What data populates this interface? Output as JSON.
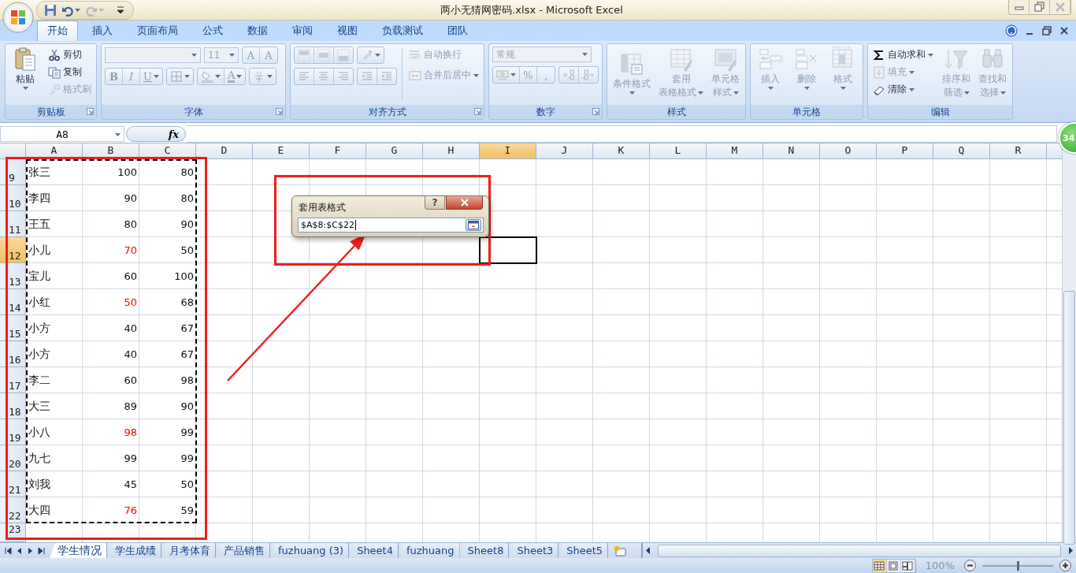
{
  "window": {
    "title": "两小无猜网密码.xlsx - Microsoft Excel"
  },
  "quick_access": [
    {
      "kind": "save",
      "disabled": false
    },
    {
      "kind": "undo",
      "disabled": false
    },
    {
      "kind": "redo",
      "disabled": true
    },
    {
      "kind": "customize",
      "disabled": false
    }
  ],
  "ribbon_tabs": [
    {
      "label": "开始",
      "selected": true
    },
    {
      "label": "插入",
      "selected": false
    },
    {
      "label": "页面布局",
      "selected": false
    },
    {
      "label": "公式",
      "selected": false
    },
    {
      "label": "数据",
      "selected": false
    },
    {
      "label": "审阅",
      "selected": false
    },
    {
      "label": "视图",
      "selected": false
    },
    {
      "label": "负载测试",
      "selected": false
    },
    {
      "label": "团队",
      "selected": false
    }
  ],
  "ribbon_groups": [
    {
      "label": "剪贴板",
      "launcher": true,
      "columns": [
        [
          [
            {
              "kind": "large",
              "lines": [
                "粘贴"
              ],
              "dropdown": true,
              "disabled": false
            }
          ]
        ],
        [
          [
            {
              "kind": "small",
              "label": "剪切",
              "dropdown": false,
              "disabled": false
            }
          ],
          [
            {
              "kind": "small",
              "label": "复制",
              "dropdown": false,
              "disabled": false
            }
          ],
          [
            {
              "kind": "small",
              "label": "格式刷",
              "dropdown": false,
              "disabled": true
            }
          ]
        ]
      ]
    },
    {
      "label": "字体",
      "launcher": true,
      "columns": [
        [
          [
            {
              "kind": "combo",
              "disabled": true
            },
            {
              "kind": "combo",
              "value": "11",
              "disabled": true
            },
            {
              "kind": "segment",
              "disabled": true,
              "buttons": [
                {
                  "label": "A",
                  "dropdown": false
                },
                {
                  "label": "A",
                  "dropdown": false
                }
              ]
            }
          ],
          [
            {
              "kind": "segment",
              "disabled": true,
              "buttons": [
                {
                  "label": "B",
                  "dropdown": false
                },
                {
                  "label": "I",
                  "dropdown": false
                },
                {
                  "label": "U",
                  "dropdown": true
                }
              ]
            },
            {
              "kind": "segment",
              "disabled": true,
              "buttons": [
                {
                  "dropdown": true
                }
              ]
            },
            {
              "kind": "segment",
              "disabled": true,
              "buttons": [
                {
                  "dropdown": true
                },
                {
                  "label": "A",
                  "dropdown": true
                }
              ]
            },
            {
              "kind": "segment",
              "disabled": true,
              "buttons": [
                {
                  "dropdown": true
                }
              ]
            }
          ]
        ]
      ]
    },
    {
      "label": "对齐方式",
      "launcher": true,
      "columns": [
        [
          [
            {
              "kind": "segment",
              "disabled": true,
              "buttons": [
                {
                  "dropdown": false
                },
                {
                  "dropdown": false
                },
                {
                  "dropdown": false
                }
              ]
            },
            {
              "kind": "segment",
              "disabled": true,
              "buttons": [
                {
                  "dropdown": true
                }
              ]
            }
          ],
          [
            {
              "kind": "segment",
              "disabled": true,
              "buttons": [
                {
                  "dropdown": false
                },
                {
                  "dropdown": false
                },
                {
                  "dropdown": false
                }
              ]
            },
            {
              "kind": "segment",
              "disabled": true,
              "buttons": [
                {
                  "dropdown": false
                },
                {
                  "dropdown": false
                }
              ]
            }
          ]
        ],
        [
          [
            {
              "kind": "small",
              "label": "自动换行",
              "dropdown": false,
              "disabled": true
            }
          ],
          [
            {
              "kind": "small",
              "label": "合并后居中",
              "dropdown": true,
              "disabled": true
            }
          ]
        ]
      ]
    },
    {
      "label": "数字",
      "launcher": true,
      "columns": [
        [
          [
            {
              "kind": "combo",
              "value": "常规",
              "disabled": true
            }
          ],
          [
            {
              "kind": "segment",
              "disabled": true,
              "buttons": [
                {
                  "dropdown": true
                },
                {
                  "label": "%",
                  "dropdown": false
                },
                {
                  "label": ",",
                  "dropdown": false
                }
              ]
            },
            {
              "kind": "segment",
              "disabled": true,
              "buttons": [
                {
                  "dropdown": false
                },
                {
                  "dropdown": false
                }
              ]
            }
          ]
        ]
      ]
    },
    {
      "label": "样式",
      "launcher": false,
      "columns": [
        [
          [
            {
              "kind": "large",
              "lines": [
                "条件格式"
              ],
              "dropdown": true,
              "disabled": true
            },
            {
              "kind": "large",
              "lines": [
                "套用",
                "表格格式"
              ],
              "dropdown": true,
              "disabled": true
            },
            {
              "kind": "large",
              "lines": [
                "单元格",
                "样式"
              ],
              "dropdown": true,
              "disabled": true
            }
          ]
        ]
      ]
    },
    {
      "label": "单元格",
      "launcher": false,
      "columns": [
        [
          [
            {
              "kind": "large",
              "lines": [
                "插入"
              ],
              "dropdown": true,
              "disabled": true
            },
            {
              "kind": "large",
              "lines": [
                "删除"
              ],
              "dropdown": true,
              "disabled": true
            },
            {
              "kind": "large",
              "lines": [
                "格式"
              ],
              "dropdown": true,
              "disabled": true
            }
          ]
        ]
      ]
    },
    {
      "label": "编辑",
      "launcher": false,
      "columns": [
        [
          [
            {
              "kind": "small",
              "label": "自动求和",
              "dropdown": true,
              "disabled": false
            }
          ],
          [
            {
              "kind": "small",
              "label": "填充",
              "dropdown": true,
              "disabled": true
            }
          ],
          [
            {
              "kind": "small",
              "label": "清除",
              "dropdown": true,
              "disabled": false
            }
          ]
        ],
        [
          [
            {
              "kind": "large",
              "lines": [
                "排序和",
                "筛选"
              ],
              "dropdown": true,
              "disabled": true
            },
            {
              "kind": "large",
              "lines": [
                "查找和",
                "选择"
              ],
              "dropdown": true,
              "disabled": true
            }
          ]
        ]
      ]
    }
  ],
  "formula_bar": {
    "name_box": "A8",
    "fx": "fx"
  },
  "sheet": {
    "marquee": true,
    "columns": [
      {
        "label": "A",
        "selected": false
      },
      {
        "label": "B",
        "selected": false
      },
      {
        "label": "C",
        "selected": false
      },
      {
        "label": "D",
        "selected": false
      },
      {
        "label": "E",
        "selected": false
      },
      {
        "label": "F",
        "selected": false
      },
      {
        "label": "G",
        "selected": false
      },
      {
        "label": "H",
        "selected": false
      },
      {
        "label": "I",
        "selected": true
      },
      {
        "label": "J",
        "selected": false
      },
      {
        "label": "K",
        "selected": false
      },
      {
        "label": "L",
        "selected": false
      },
      {
        "label": "M",
        "selected": false
      },
      {
        "label": "N",
        "selected": false
      },
      {
        "label": "O",
        "selected": false
      },
      {
        "label": "P",
        "selected": false
      },
      {
        "label": "Q",
        "selected": false
      },
      {
        "label": "R",
        "selected": false
      }
    ],
    "rows": [
      {
        "header": "9",
        "selected": false,
        "cells": [
          {
            "text": "张三",
            "highlighted": false
          },
          {
            "text": "100",
            "highlighted": false
          },
          {
            "text": "80",
            "highlighted": false
          }
        ]
      },
      {
        "header": "10",
        "selected": false,
        "cells": [
          {
            "text": "李四",
            "highlighted": false
          },
          {
            "text": "90",
            "highlighted": false
          },
          {
            "text": "80",
            "highlighted": false
          }
        ]
      },
      {
        "header": "11",
        "selected": false,
        "cells": [
          {
            "text": "王五",
            "highlighted": false
          },
          {
            "text": "80",
            "highlighted": false
          },
          {
            "text": "90",
            "highlighted": false
          }
        ]
      },
      {
        "header": "12",
        "selected": true,
        "cells": [
          {
            "text": "小儿",
            "highlighted": false
          },
          {
            "text": "70",
            "highlighted": true
          },
          {
            "text": "50",
            "highlighted": false
          }
        ]
      },
      {
        "header": "13",
        "selected": false,
        "cells": [
          {
            "text": "宝儿",
            "highlighted": false
          },
          {
            "text": "60",
            "highlighted": false
          },
          {
            "text": "100",
            "highlighted": false
          }
        ]
      },
      {
        "header": "14",
        "selected": false,
        "cells": [
          {
            "text": "小红",
            "highlighted": false
          },
          {
            "text": "50",
            "highlighted": true
          },
          {
            "text": "68",
            "highlighted": false
          }
        ]
      },
      {
        "header": "15",
        "selected": false,
        "cells": [
          {
            "text": "小方",
            "highlighted": false
          },
          {
            "text": "40",
            "highlighted": false
          },
          {
            "text": "67",
            "highlighted": false
          }
        ]
      },
      {
        "header": "16",
        "selected": false,
        "cells": [
          {
            "text": "小方",
            "highlighted": false
          },
          {
            "text": "40",
            "highlighted": false
          },
          {
            "text": "67",
            "highlighted": false
          }
        ]
      },
      {
        "header": "17",
        "selected": false,
        "cells": [
          {
            "text": "李二",
            "highlighted": false
          },
          {
            "text": "60",
            "highlighted": false
          },
          {
            "text": "98",
            "highlighted": false
          }
        ]
      },
      {
        "header": "18",
        "selected": false,
        "cells": [
          {
            "text": "大三",
            "highlighted": false
          },
          {
            "text": "89",
            "highlighted": false
          },
          {
            "text": "90",
            "highlighted": false
          }
        ]
      },
      {
        "header": "19",
        "selected": false,
        "cells": [
          {
            "text": "小八",
            "highlighted": false
          },
          {
            "text": "98",
            "highlighted": true
          },
          {
            "text": "99",
            "highlighted": false
          }
        ]
      },
      {
        "header": "20",
        "selected": false,
        "cells": [
          {
            "text": "九七",
            "highlighted": false
          },
          {
            "text": "99",
            "highlighted": false
          },
          {
            "text": "99",
            "highlighted": false
          }
        ]
      },
      {
        "header": "21",
        "selected": false,
        "cells": [
          {
            "text": "刘我",
            "highlighted": false
          },
          {
            "text": "45",
            "highlighted": false
          },
          {
            "text": "50",
            "highlighted": false
          }
        ]
      },
      {
        "header": "22",
        "selected": false,
        "cells": [
          {
            "text": "大四",
            "highlighted": false
          },
          {
            "text": "76",
            "highlighted": true
          },
          {
            "text": "59",
            "highlighted": false
          }
        ]
      },
      {
        "header": "23",
        "selected": false
      }
    ]
  },
  "dialog": {
    "title": "套用表格式",
    "help": "?",
    "value": "$A$8:$C$22"
  },
  "annotations": [
    {
      "kind": "frame"
    },
    {
      "kind": "frame"
    },
    {
      "kind": "arrow"
    }
  ],
  "badge": "34",
  "sheet_tabs": [
    {
      "label": "学生情况",
      "selected": true
    },
    {
      "label": "学生成绩",
      "selected": false
    },
    {
      "label": "月考体育",
      "selected": false
    },
    {
      "label": "产品销售",
      "selected": false
    },
    {
      "label": "fuzhuang (3)",
      "selected": false
    },
    {
      "label": "Sheet4",
      "selected": false
    },
    {
      "label": "fuzhuang",
      "selected": false
    },
    {
      "label": "Sheet8",
      "selected": false
    },
    {
      "label": "Sheet3",
      "selected": false
    },
    {
      "label": "Sheet5",
      "selected": false
    }
  ],
  "status_bar": {
    "views": [
      {
        "selected": true
      },
      {
        "selected": false
      },
      {
        "selected": false
      }
    ],
    "zoom": "100%",
    "zoom_slider": {
      "level": 0.5
    }
  }
}
